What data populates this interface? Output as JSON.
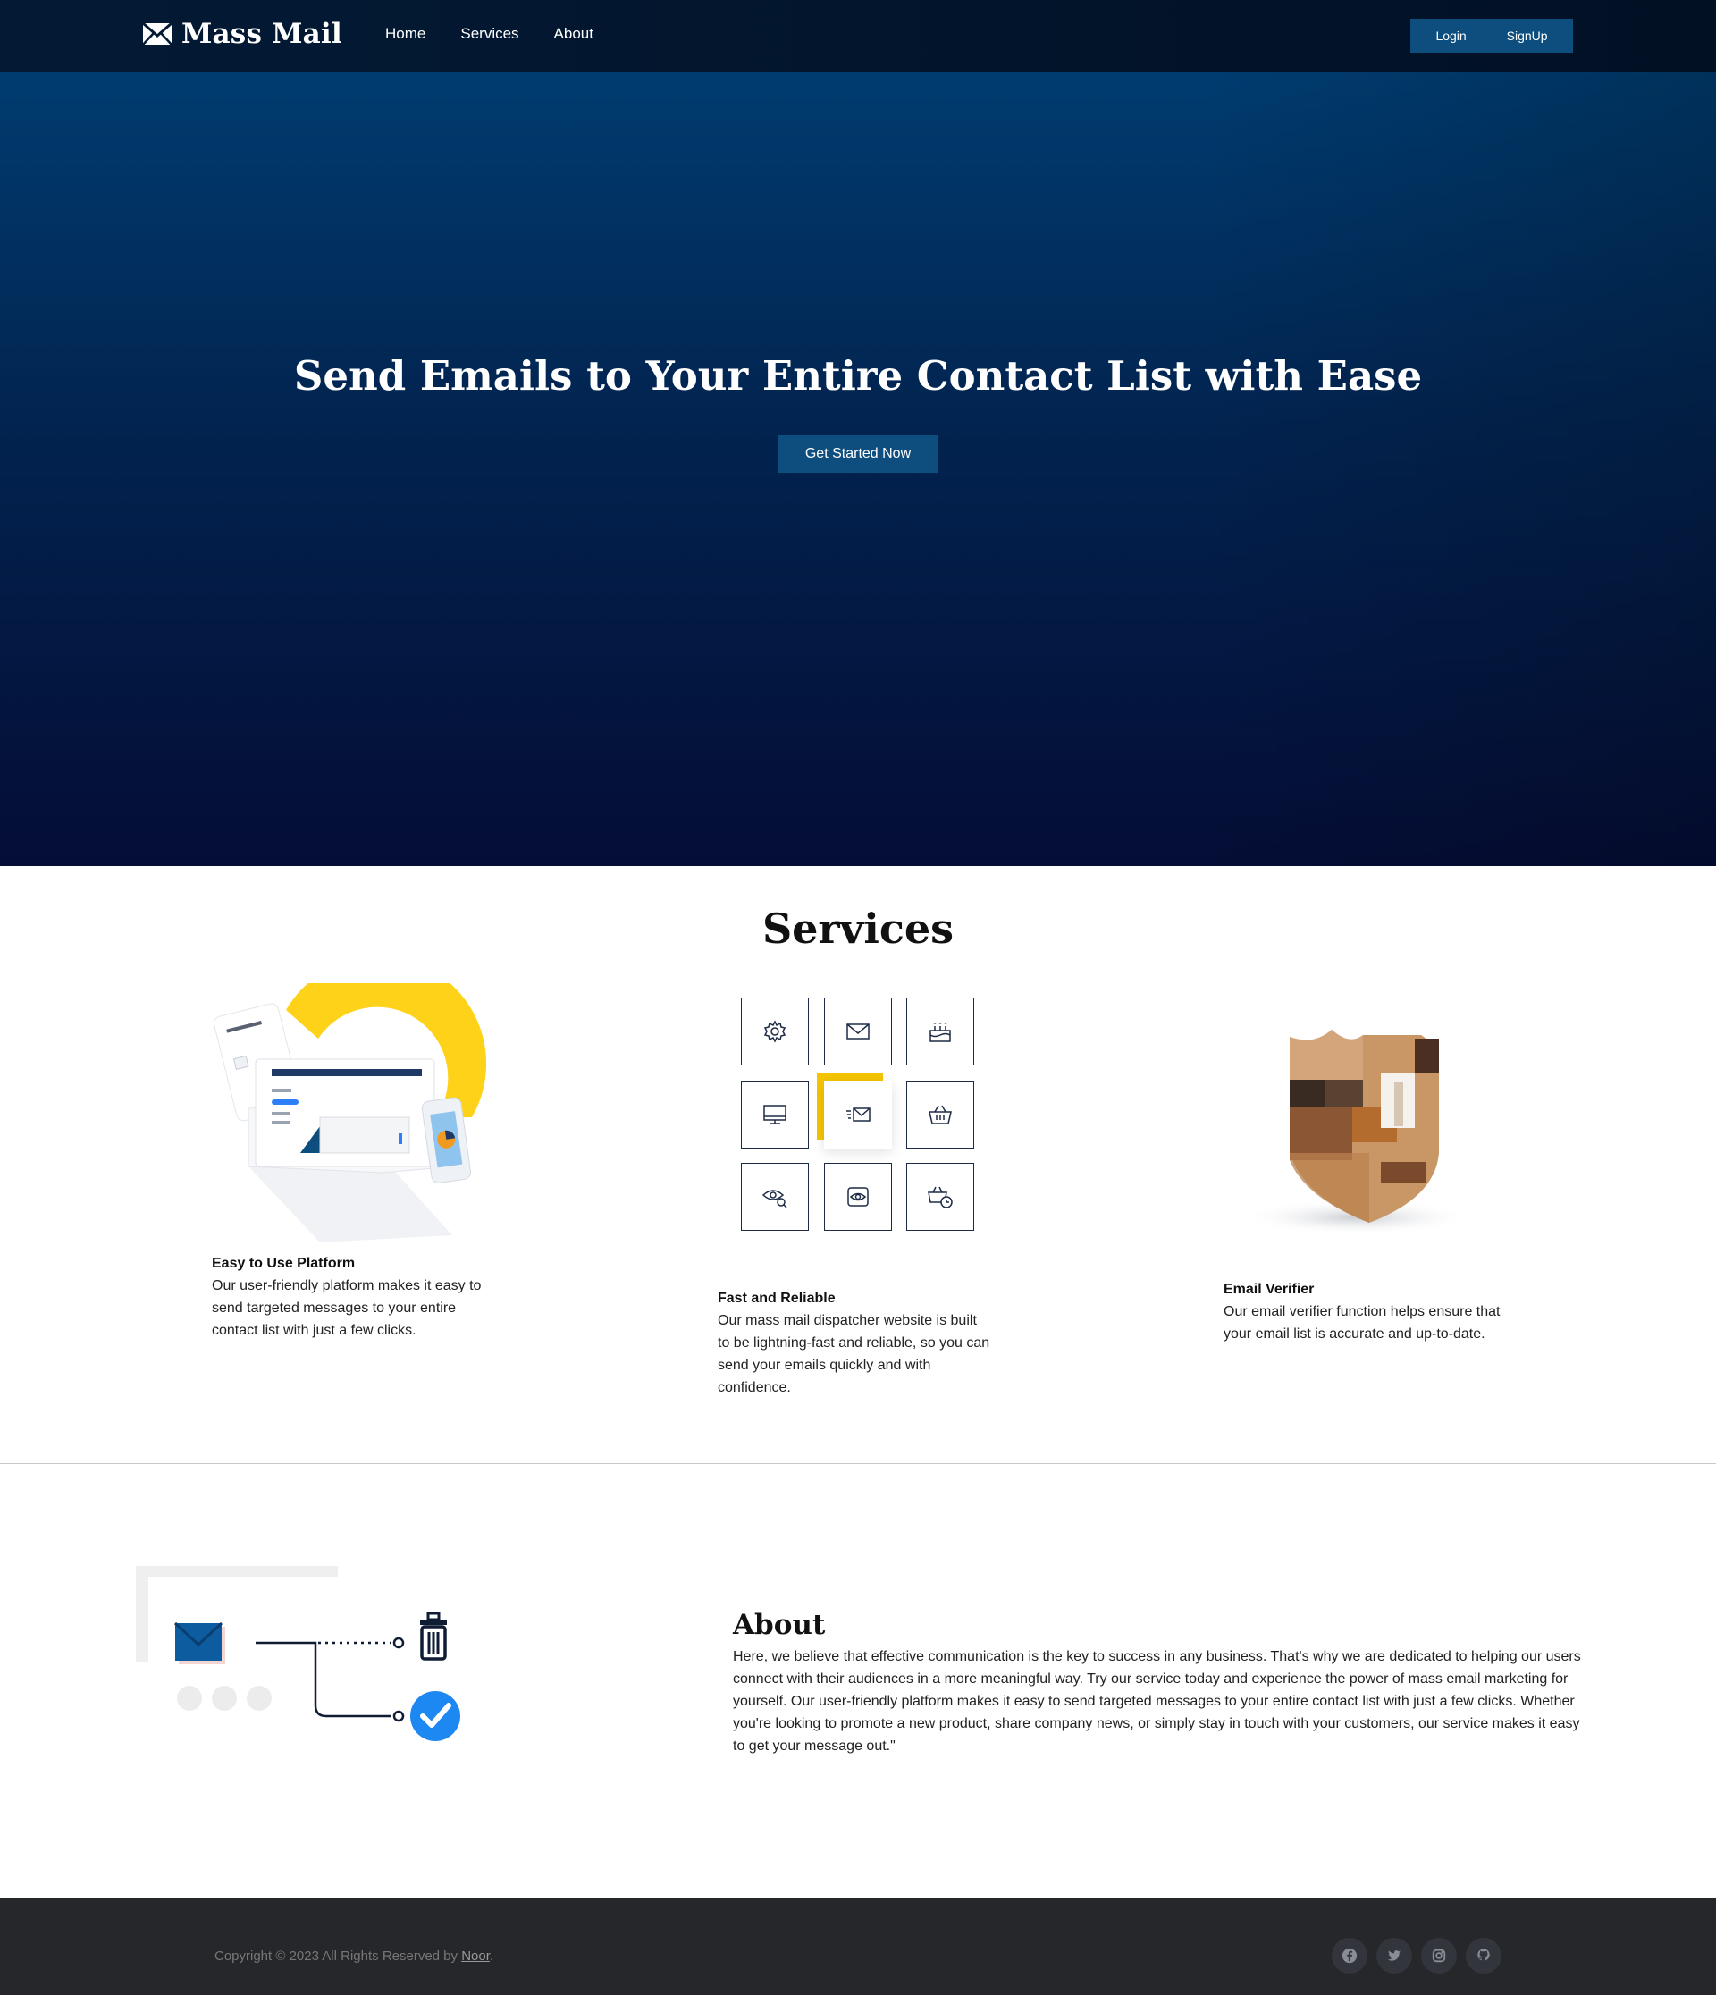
{
  "nav": {
    "brand": "Mass Mail",
    "brand_icon": "envelope-icon",
    "links": [
      "Home",
      "Services",
      "About"
    ],
    "login": "Login",
    "signup": "SignUp"
  },
  "hero": {
    "title": "Send Emails to Your Entire Contact List with Ease",
    "cta": "Get Started Now"
  },
  "services": {
    "title": "Services",
    "items": [
      {
        "title": "Easy to Use Platform",
        "desc": "Our user-friendly platform makes it easy to send targeted messages to your entire contact list with just a few clicks."
      },
      {
        "title": "Fast and Reliable",
        "desc": "Our mass mail dispatcher website is built to be lightning-fast and reliable, so you can send your emails quickly and with confidence."
      },
      {
        "title": "Email Verifier",
        "desc": "Our email verifier function helps ensure that your email list is accurate and up-to-date."
      }
    ],
    "grid_icons": [
      "gear-icon",
      "envelope-icon",
      "cake-icon",
      "monitor-icon",
      "sending-envelope-icon",
      "basket-icon",
      "eye-search-icon",
      "eye-icon",
      "basket-clock-icon"
    ]
  },
  "about": {
    "title": "About",
    "text": "Here, we believe that effective communication is the key to success in any business. That's why we are dedicated to helping our users connect with their audiences in a more meaningful way. Try our service today and experience the power of mass email marketing for yourself. Our user-friendly platform makes it easy to send targeted messages to your entire contact list with just a few clicks. Whether you're looking to promote a new product, share company news, or simply stay in touch with your customers, our service makes it easy to get your message out.\""
  },
  "footer": {
    "copyright_prefix": "Copyright © 2023 All Rights Reserved by ",
    "copyright_name": "Noor",
    "copyright_suffix": ".",
    "social": [
      "facebook-icon",
      "twitter-icon",
      "instagram-icon",
      "github-icon"
    ]
  },
  "colors": {
    "nav_bg": "#031a35",
    "accent_button": "#0d4e7e",
    "hero_top": "#003c70",
    "hero_bottom": "#040d35",
    "highlight_yellow": "#f5c500",
    "footer_bg": "#26272b"
  }
}
